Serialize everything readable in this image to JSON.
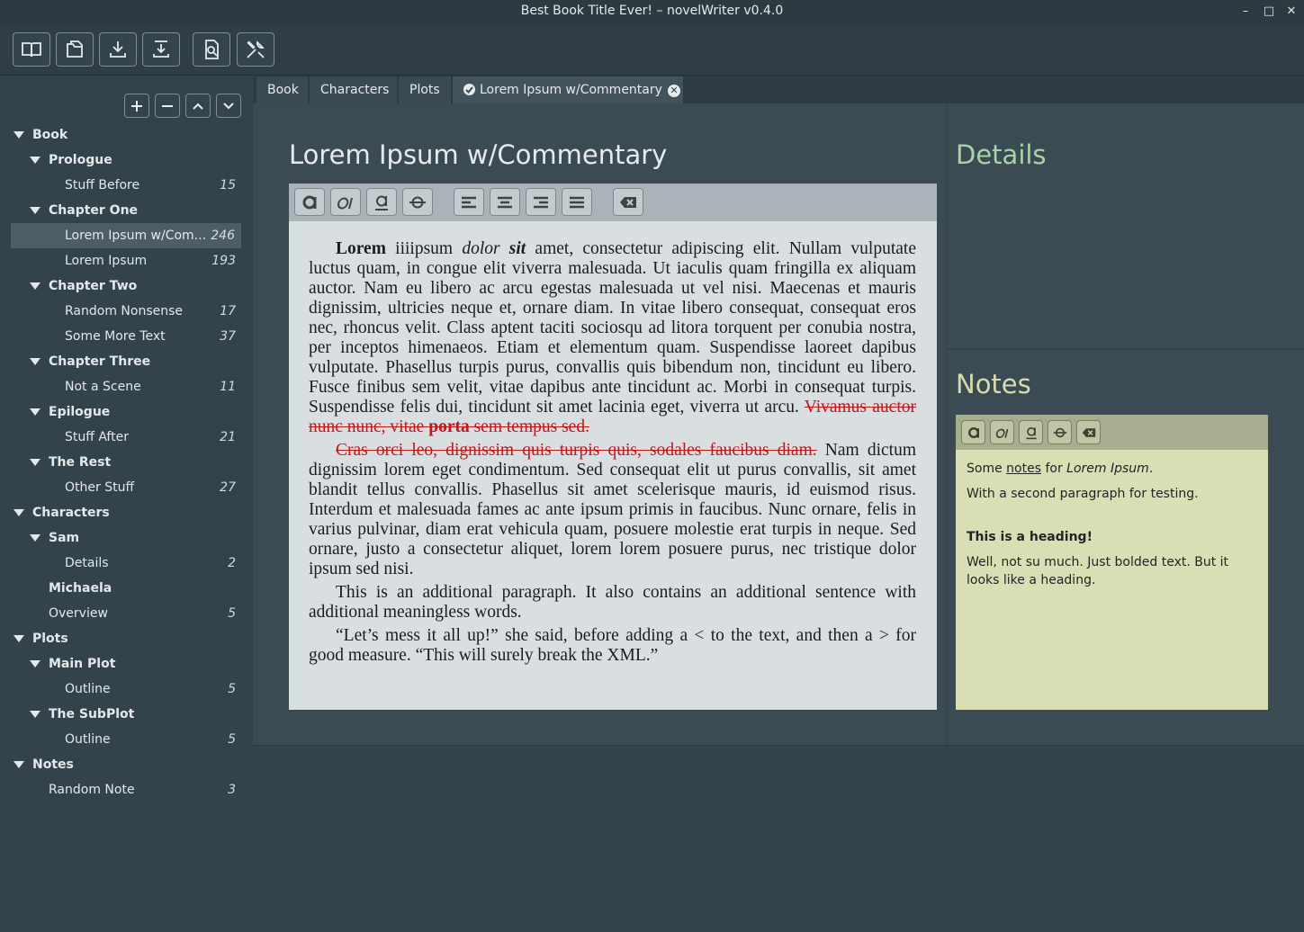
{
  "window": {
    "title": "Best Book Title Ever! – novelWriter v0.4.0",
    "minimize": "–",
    "maximize": "□",
    "close": "✕"
  },
  "toolbar": {
    "icons": [
      "book-icon",
      "open-project-icon",
      "save-icon",
      "save-all-icon",
      "preview-icon",
      "tools-icon"
    ]
  },
  "tree": {
    "buttons": [
      "add-icon",
      "remove-icon",
      "move-up-icon",
      "move-down-icon"
    ],
    "items": [
      {
        "label": "Book",
        "level": 0,
        "expandable": true,
        "bold": true,
        "count": ""
      },
      {
        "label": "Prologue",
        "level": 1,
        "expandable": true,
        "bold": true,
        "count": ""
      },
      {
        "label": "Stuff Before",
        "level": 2,
        "expandable": false,
        "bold": false,
        "count": "15"
      },
      {
        "label": "Chapter One",
        "level": 1,
        "expandable": true,
        "bold": true,
        "count": ""
      },
      {
        "label": "Lorem Ipsum w/Com...",
        "level": 2,
        "expandable": false,
        "bold": false,
        "count": "246",
        "selected": true
      },
      {
        "label": "Lorem Ipsum",
        "level": 2,
        "expandable": false,
        "bold": false,
        "count": "193"
      },
      {
        "label": "Chapter Two",
        "level": 1,
        "expandable": true,
        "bold": true,
        "count": ""
      },
      {
        "label": "Random Nonsense",
        "level": 2,
        "expandable": false,
        "bold": false,
        "count": "17"
      },
      {
        "label": "Some More Text",
        "level": 2,
        "expandable": false,
        "bold": false,
        "count": "37"
      },
      {
        "label": "Chapter Three",
        "level": 1,
        "expandable": true,
        "bold": true,
        "count": ""
      },
      {
        "label": "Not a Scene",
        "level": 2,
        "expandable": false,
        "bold": false,
        "count": "11"
      },
      {
        "label": "Epilogue",
        "level": 1,
        "expandable": true,
        "bold": true,
        "count": ""
      },
      {
        "label": "Stuff After",
        "level": 2,
        "expandable": false,
        "bold": false,
        "count": "21"
      },
      {
        "label": "The Rest",
        "level": 1,
        "expandable": true,
        "bold": true,
        "count": ""
      },
      {
        "label": "Other Stuff",
        "level": 2,
        "expandable": false,
        "bold": false,
        "count": "27"
      },
      {
        "label": "Characters",
        "level": 0,
        "expandable": true,
        "bold": true,
        "count": ""
      },
      {
        "label": "Sam",
        "level": 1,
        "expandable": true,
        "bold": true,
        "count": ""
      },
      {
        "label": "Details",
        "level": 2,
        "expandable": false,
        "bold": false,
        "count": "2"
      },
      {
        "label": "Michaela",
        "level": 1,
        "expandable": false,
        "bold": true,
        "count": ""
      },
      {
        "label": "Overview",
        "level": 1,
        "expandable": false,
        "bold": false,
        "count": "5"
      },
      {
        "label": "Plots",
        "level": 0,
        "expandable": true,
        "bold": true,
        "count": ""
      },
      {
        "label": "Main Plot",
        "level": 1,
        "expandable": true,
        "bold": true,
        "count": ""
      },
      {
        "label": "Outline",
        "level": 2,
        "expandable": false,
        "bold": false,
        "count": "5"
      },
      {
        "label": "The SubPlot",
        "level": 1,
        "expandable": true,
        "bold": true,
        "count": ""
      },
      {
        "label": "Outline",
        "level": 2,
        "expandable": false,
        "bold": false,
        "count": "5"
      },
      {
        "label": "Notes",
        "level": 0,
        "expandable": true,
        "bold": true,
        "count": ""
      },
      {
        "label": "Random Note",
        "level": 1,
        "expandable": false,
        "bold": false,
        "count": "3"
      }
    ]
  },
  "tabs": [
    {
      "label": "Book",
      "active": false
    },
    {
      "label": "Characters",
      "active": false
    },
    {
      "label": "Plots",
      "active": false
    },
    {
      "label": "Lorem Ipsum w/Commentary",
      "active": true,
      "closable": true
    }
  ],
  "editor": {
    "title": "Lorem Ipsum w/Commentary",
    "format_buttons": [
      "bold-icon",
      "italic-icon",
      "underline-icon",
      "strikethrough-icon",
      "align-left-icon",
      "align-center-icon",
      "align-right-icon",
      "justify-icon",
      "clear-format-icon"
    ],
    "p1": {
      "bold1": "Lorem",
      "t1": " iiiipsum ",
      "italic1": "dolor",
      "t2": " ",
      "bolditalic1": "sit",
      "t3": " amet, consectetur adipiscing elit. Nullam vulputate luctus quam, in congue elit viverra malesuada. Ut iaculis quam fringilla ex aliquam auctor. Nam eu libero ac arcu egestas malesuada ut vel nisi. Maecenas et mauris dignissim, ultricies neque et, ornare diam. In vitae libero consequat, consequat eros nec, rhoncus velit. Class aptent taciti sociosqu ad litora torquent per conubia nostra, per inceptos himenaeos. Etiam et elementum quam. Suspendisse laoreet dapibus vulputate. Phasellus turpis purus, convallis quis bibendum non, tincidunt eu libero. Fusce finibus sem velit, vitae dapibus ante tincidunt ac. Morbi in consequat turpis. Suspendisse felis dui, tincidunt sit amet lacinia eget, viverra ut arcu. ",
      "del1": "Vivamus auctor nunc nunc, vitae ",
      "delbold": "porta",
      "del2": " sem tempus sed."
    },
    "p2": {
      "del": "Cras orci leo, dignissim quis turpis quis, sodales faucibus diam.",
      "t": " Nam dictum dignissim lorem eget condimentum. Sed consequat elit ut purus convallis, sit amet blandit tellus convallis. Phasellus sit amet scelerisque mauris, id euismod risus. Interdum et malesuada fames ac ante ipsum primis in faucibus. Nunc ornare, felis in varius pulvinar, diam erat vehicula quam, posuere molestie erat turpis in neque. Sed ornare, justo a consectetur aliquet, lorem lorem posuere purus, nec tristique dolor ipsum sed nisi."
    },
    "p3": "This is an additional paragraph. It also contains an additional sentence with additional meaningless words.",
    "p4": "“Let’s mess it all up!” she said, before adding a < to the text, and then a > for good measure. “This will surely break the XML.”"
  },
  "details": {
    "title": "Details"
  },
  "notes": {
    "title": "Notes",
    "format_buttons": [
      "bold-icon",
      "italic-icon",
      "underline-icon",
      "strikethrough-icon",
      "clear-format-icon"
    ],
    "line1_a": "Some ",
    "line1_u": "notes",
    "line1_b": " for ",
    "line1_i": "Lorem Ipsum",
    "line1_c": ".",
    "line2": "With a second paragraph for testing.",
    "heading": "This is a heading!",
    "line3": "Well, not su much. Just bolded text. But it looks like a heading."
  },
  "colors": {
    "details_title": "#a9d3a6",
    "notes_title": "#d6dcae",
    "deleted_text": "#c0151a"
  }
}
